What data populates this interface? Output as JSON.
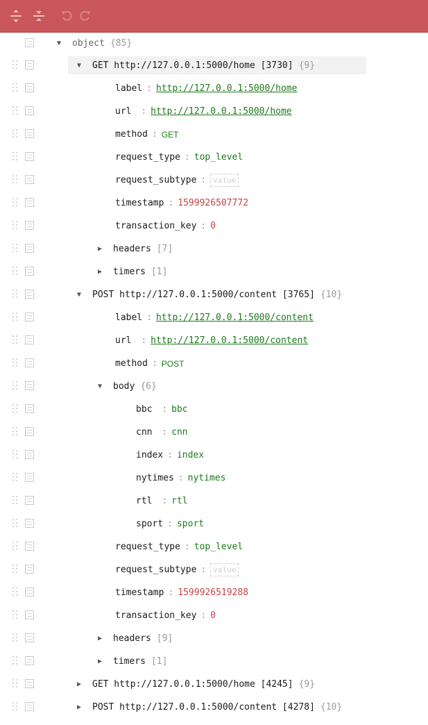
{
  "toolbar": {
    "expand_all_title": "Expand all fields",
    "collapse_all_title": "Collapse all fields",
    "undo_title": "Undo last action",
    "redo_title": "Redo",
    "color": "#c8565a"
  },
  "tree": {
    "root": {
      "key": "object",
      "count": "{85}"
    },
    "req1": {
      "key": "GET http://127.0.0.1:5000/home [3730]",
      "count": "{9}"
    },
    "req1_label": {
      "key": "label",
      "value": "http://127.0.0.1:5000/home"
    },
    "req1_url": {
      "key": "url ",
      "value": "http://127.0.0.1:5000/home"
    },
    "req1_method": {
      "key": "method",
      "value": "GET"
    },
    "req1_request_type": {
      "key": "request_type",
      "value": "top_level"
    },
    "req1_request_subtype": {
      "key": "request_subtype",
      "value": "value"
    },
    "req1_timestamp": {
      "key": "timestamp",
      "value": "1599926507772"
    },
    "req1_transaction_key": {
      "key": "transaction_key",
      "value": "0"
    },
    "req1_headers": {
      "key": "headers",
      "count": "[7]"
    },
    "req1_timers": {
      "key": "timers",
      "count": "[1]"
    },
    "req2": {
      "key": "POST http://127.0.0.1:5000/content [3765]",
      "count": "{10}"
    },
    "req2_label": {
      "key": "label",
      "value": "http://127.0.0.1:5000/content"
    },
    "req2_url": {
      "key": "url ",
      "value": "http://127.0.0.1:5000/content"
    },
    "req2_method": {
      "key": "method",
      "value": "POST"
    },
    "req2_body": {
      "key": "body",
      "count": "{6}"
    },
    "body_bbc": {
      "key": "bbc ",
      "value": "bbc"
    },
    "body_cnn": {
      "key": "cnn ",
      "value": "cnn"
    },
    "body_index": {
      "key": "index",
      "value": "index"
    },
    "body_nytimes": {
      "key": "nytimes",
      "value": "nytimes"
    },
    "body_rtl": {
      "key": "rtl ",
      "value": "rtl"
    },
    "body_sport": {
      "key": "sport",
      "value": "sport"
    },
    "req2_request_type": {
      "key": "request_type",
      "value": "top_level"
    },
    "req2_request_subtype": {
      "key": "request_subtype",
      "value": "value"
    },
    "req2_timestamp": {
      "key": "timestamp",
      "value": "1599926519288"
    },
    "req2_transaction_key": {
      "key": "transaction_key",
      "value": "0"
    },
    "req2_headers": {
      "key": "headers",
      "count": "[9]"
    },
    "req2_timers": {
      "key": "timers",
      "count": "[1]"
    },
    "req3": {
      "key": "GET http://127.0.0.1:5000/home [4245]",
      "count": "{9}"
    },
    "req4": {
      "key": "POST http://127.0.0.1:5000/content [4278]",
      "count": "{10}"
    }
  },
  "colors": {
    "string": "#1a7a1a",
    "number": "#c94040",
    "muted": "#9a9a9a"
  }
}
